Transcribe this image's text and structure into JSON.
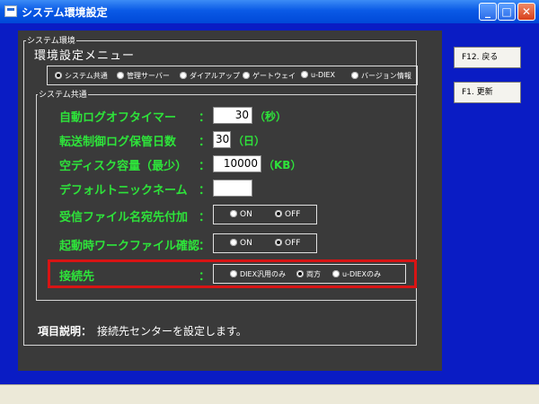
{
  "window": {
    "title": "システム環境設定",
    "close_glyph": "✕",
    "max_glyph": "□",
    "min_glyph": "_"
  },
  "colors": {
    "desktop_blue": "#0a1cc4",
    "panel": "#3a3a3a",
    "label_green": "#2ee33a",
    "highlight_red": "#d81414"
  },
  "outer_group": {
    "legend": "システム環境",
    "menu_title": "環境設定メニュー"
  },
  "tabs": [
    {
      "label": "システム共通",
      "selected": true
    },
    {
      "label": "管理サーバー",
      "selected": false
    },
    {
      "label": "ダイアルアップ",
      "selected": false
    },
    {
      "label": "ゲートウェイ",
      "selected": false
    },
    {
      "label": "u-DIEX",
      "selected": false
    },
    {
      "label": "バージョン情報",
      "selected": false
    }
  ],
  "common": {
    "legend": "システム共通",
    "colon": "：",
    "auto_logoff": {
      "label": "自動ログオフタイマー",
      "value": "30",
      "unit": "（秒）"
    },
    "log_days": {
      "label": "転送制御ログ保管日数",
      "value": "30",
      "unit": "（日）"
    },
    "disk_space": {
      "label": "空ディスク容量（最少）",
      "value": "10000",
      "unit": "（KB）"
    },
    "nickname": {
      "label": "デフォルトニックネーム",
      "value": ""
    },
    "recv_name": {
      "label": "受信ファイル名宛先付加",
      "options": [
        {
          "label": "ON",
          "selected": false
        },
        {
          "label": "OFF",
          "selected": true
        }
      ]
    },
    "startup_check": {
      "label": "起動時ワークファイル確認",
      "options": [
        {
          "label": "ON",
          "selected": false
        },
        {
          "label": "OFF",
          "selected": true
        }
      ]
    },
    "connection": {
      "label": "接続先",
      "options": [
        {
          "label": "DIEX汎用のみ",
          "selected": false
        },
        {
          "label": "両方",
          "selected": true
        },
        {
          "label": "u-DIEXのみ",
          "selected": false
        }
      ]
    }
  },
  "description": {
    "label": "項目説明：",
    "text": "接続先センターを設定します。"
  },
  "side_buttons": {
    "back": "F12. 戻る",
    "update": "F1. 更新"
  }
}
